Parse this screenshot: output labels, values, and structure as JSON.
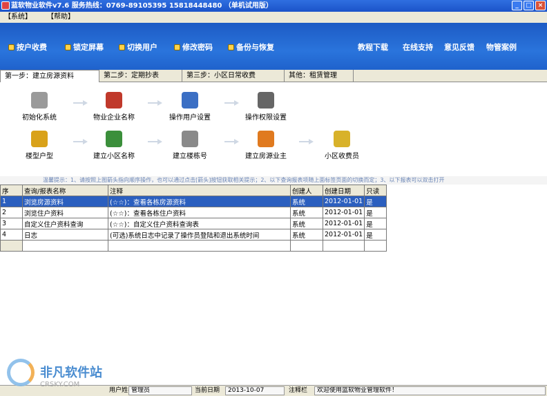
{
  "window": {
    "title": "蓝软物业软件v7.6 服务热线：0769-89105395 15818448480 （单机试用版）",
    "controls": [
      "_",
      "□",
      "×"
    ]
  },
  "menu": {
    "items": [
      "【系统】",
      "【帮助】"
    ]
  },
  "toolbar": {
    "left_items": [
      {
        "label": "按户收费",
        "icon": "charge-icon"
      },
      {
        "label": "锁定屏幕",
        "icon": "lock-icon"
      },
      {
        "label": "切换用户",
        "icon": "switch-user-icon"
      },
      {
        "label": "修改密码",
        "icon": "key-icon"
      },
      {
        "label": "备份与恢复",
        "icon": "backup-icon"
      }
    ],
    "right_links": [
      "教程下载",
      "在线支持",
      "意见反馈",
      "物管案例"
    ]
  },
  "tabs": [
    {
      "label": "第一步：建立房源资料",
      "active": true
    },
    {
      "label": "第二步：定期抄表",
      "active": false
    },
    {
      "label": "第三步：小区日常收费",
      "active": false
    },
    {
      "label": "其他：租赁管理",
      "active": false
    }
  ],
  "flow": {
    "row1": [
      {
        "label": "初始化系统",
        "icon": "init-icon",
        "color": "#9a9a9a"
      },
      {
        "label": "物业企业名称",
        "icon": "company-icon",
        "color": "#c0392b"
      },
      {
        "label": "操作用户设置",
        "icon": "user-setting-icon",
        "color": "#3b6fc4"
      },
      {
        "label": "操作权限设置",
        "icon": "permission-icon",
        "color": "#666666"
      }
    ],
    "row2": [
      {
        "label": "楼型户型",
        "icon": "building-type-icon",
        "color": "#d9a21a"
      },
      {
        "label": "建立小区名称",
        "icon": "community-icon",
        "color": "#3b8f3b"
      },
      {
        "label": "建立楼栋号",
        "icon": "building-icon",
        "color": "#8a8a8a"
      },
      {
        "label": "建立房源业主",
        "icon": "house-icon",
        "color": "#e07a1f"
      },
      {
        "label": "小区收费员",
        "icon": "collector-icon",
        "color": "#d8b22a"
      }
    ]
  },
  "hint": "温馨提示：1、请按照上图箭头指向顺序操作，也可以通过点击[箭头]按钮获取相关提示；2、以下查询报表项随上面标签页面的切换而定；3、以下报表可以双击打开",
  "grid": {
    "columns": [
      "序",
      "查询/报表名称",
      "注释",
      "创建人",
      "创建日期",
      "只读"
    ],
    "rows": [
      {
        "no": "1",
        "name": "浏览房源资料",
        "note": "(☆☆)：查看各栋房源资料",
        "creator": "系统",
        "date": "2012-01-01",
        "ro": "是"
      },
      {
        "no": "2",
        "name": "浏览住户资料",
        "note": "(☆☆)：查看各栋住户资料",
        "creator": "系统",
        "date": "2012-01-01",
        "ro": "是"
      },
      {
        "no": "3",
        "name": "自定义住户资料查询",
        "note": "(☆☆)：自定义住户资料查询表",
        "creator": "系统",
        "date": "2012-01-01",
        "ro": "是"
      },
      {
        "no": "4",
        "name": "日志",
        "note": "(可选)系统日志中记录了操作员登陆和退出系统时间",
        "creator": "系统",
        "date": "2012-01-01",
        "ro": "是"
      }
    ]
  },
  "status": {
    "user_label": "用户姓名",
    "user_value": "管理员",
    "date_label": "当前日期",
    "date_value": "2013-10-07",
    "note_label": "注释栏",
    "note_value": "欢迎使用蓝软物业管理软件！"
  },
  "watermark": {
    "cn": "非凡软件站",
    "en": "CRSKY.COM"
  }
}
